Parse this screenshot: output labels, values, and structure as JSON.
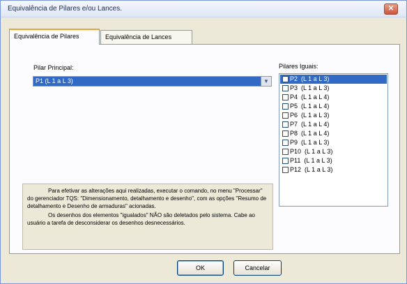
{
  "window": {
    "title": "Equivalência de Pilares e/ou Lances.",
    "close_label": "✕"
  },
  "tabs": [
    {
      "label": "Equivalência de Pilares",
      "active": true
    },
    {
      "label": "Equivalência de Lances",
      "active": false
    }
  ],
  "pilar_principal": {
    "label": "Pilar Principal:",
    "value": "P1  (L 1 a L 3)",
    "arrow": "▼"
  },
  "pilares_iguais": {
    "label": "Pilares Iguais:",
    "items": [
      {
        "text": "P2  (L 1 a L 3)",
        "selected": true
      },
      {
        "text": "P3  (L 1 a L 3)",
        "selected": false
      },
      {
        "text": "P4  (L 1 a L 4)",
        "selected": false
      },
      {
        "text": "P5  (L 1 a L 4)",
        "selected": false
      },
      {
        "text": "P6  (L 1 a L 3)",
        "selected": false
      },
      {
        "text": "P7  (L 1 a L 4)",
        "selected": false
      },
      {
        "text": "P8  (L 1 a L 4)",
        "selected": false
      },
      {
        "text": "P9  (L 1 a L 3)",
        "selected": false
      },
      {
        "text": "P10  (L 1 a L 3)",
        "selected": false
      },
      {
        "text": "P11  (L 1 a L 3)",
        "selected": false
      },
      {
        "text": "P12  (L 1 a L 3)",
        "selected": false
      }
    ]
  },
  "note": {
    "paragraph1": "Para efetivar as alterações aqui realizadas, executar o comando, no menu \"Processar\" do gerenciador TQS: \"Dimensionamento, detalhamento e desenho\", com as opções \"Resumo de detalhamento e Desenho de armaduras\" acionadas.",
    "paragraph2": "Os desenhos dos elementos \"igualados\" NÃO são deletados pelo sistema. Cabe ao usuário a tarefa de desconsiderar os desenhos desnecessários."
  },
  "buttons": {
    "ok": "OK",
    "cancel": "Cancelar"
  },
  "colors": {
    "selection": "#316ac5",
    "background": "#ece9d8",
    "panel": "#fcfcfe"
  }
}
